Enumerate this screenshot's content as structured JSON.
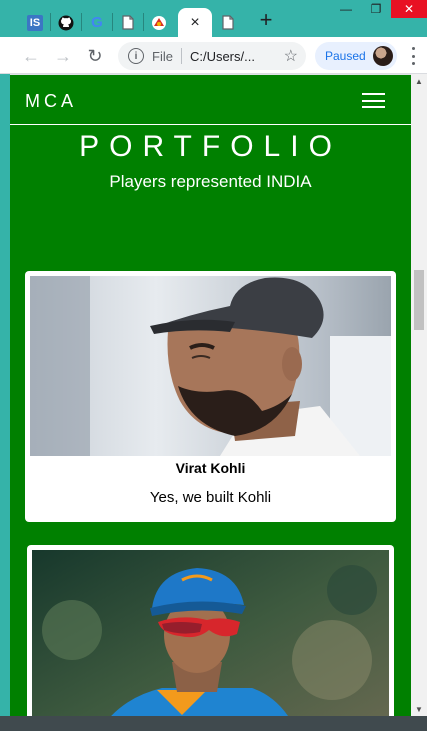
{
  "browser": {
    "tabs": [
      {
        "label": "IS",
        "icon": "site-is-icon"
      },
      {
        "label": "",
        "icon": "github-icon"
      },
      {
        "label": "G",
        "icon": "google-icon"
      },
      {
        "label": "",
        "icon": "document-icon"
      },
      {
        "label": "",
        "icon": "site-logo-icon"
      },
      {
        "label": "×",
        "icon": "close-tab-icon"
      },
      {
        "label": "",
        "icon": "document-icon"
      }
    ],
    "new_tab": "+",
    "address": {
      "scheme": "File",
      "url": "C:/Users/..."
    },
    "profile": {
      "label": "Paused"
    },
    "window_controls": {
      "minimize": "—",
      "maximize": "❐",
      "close": "✕"
    }
  },
  "page": {
    "brand": "MCA",
    "hero_title": "PORTFOLIO",
    "hero_subtitle": "Players represented INDIA",
    "cards": [
      {
        "name": "Virat Kohli",
        "caption": "Yes, we built Kohli"
      },
      {
        "name": "",
        "caption": ""
      }
    ]
  },
  "colors": {
    "page_background": "#008000",
    "tabstrip": "#35b3a9",
    "accent": "#1a73e8"
  }
}
